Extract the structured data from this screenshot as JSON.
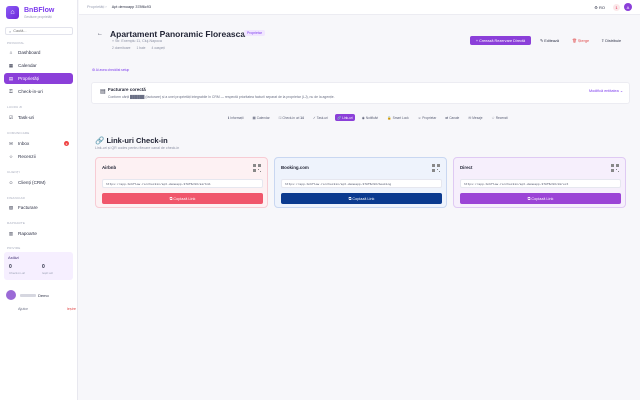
{
  "colors": {
    "accent": "#8b3fd9",
    "danger": "#e14b4b",
    "airbnb": "#f0566b",
    "booking": "#0b3a8f",
    "direct": "#9b44d6"
  },
  "sidebar": {
    "brand_name": "BnBFlow",
    "brand_sub": "Gestiune proprietăți",
    "search_placeholder": "Caută...",
    "sections": [
      "Principal",
      "Lucru zi",
      "Comunicare",
      "Clienți",
      "Financiar",
      "Rapoarte",
      "Privire"
    ],
    "items": [
      {
        "label": "Dashboard",
        "icon": "home-icon"
      },
      {
        "label": "Calendar",
        "icon": "calendar-icon"
      },
      {
        "label": "Proprietăți",
        "icon": "building-icon"
      },
      {
        "label": "Check-in-uri",
        "icon": "key-icon"
      },
      {
        "label": "Task-uri",
        "icon": "checklist-icon"
      },
      {
        "label": "Inbox",
        "icon": "inbox-icon",
        "badge": "3"
      },
      {
        "label": "Recenzii",
        "icon": "star-icon"
      },
      {
        "label": "Clienți (CRM)",
        "icon": "users-icon"
      },
      {
        "label": "Facturare",
        "icon": "invoice-icon"
      },
      {
        "label": "Rapoarte",
        "icon": "chart-icon"
      }
    ],
    "activity": {
      "title": "Astăzi",
      "checkins": "0",
      "checkins_label": "Check-in-uri",
      "checkouts": "0",
      "checkouts_label": "Ieșiri azi"
    },
    "user_name": "Demo",
    "account": "Ajutor",
    "logout": "Ieșire"
  },
  "topbar": {
    "crumb_root": "Proprietăți",
    "crumb_current": "Apt demoapp 378f6c93",
    "lang": "RO",
    "bell_count": "1",
    "avatar": "A"
  },
  "header": {
    "title": "Apartament Panoramic Floreasca",
    "badge": "Proprietar",
    "address": "Str. Exemplu 11, Cluj-Napoca",
    "stats": [
      "2 dormitoare",
      "1 baie",
      "4 oaspeți"
    ],
    "primary_btn": "+ Creează Rezervare Directă",
    "edit_btn": "Editează",
    "delete_btn": "Șterge",
    "share_btn": "Distribuie"
  },
  "notice_link": "Ai avea checklist setup",
  "invoice": {
    "title": "Facturare corectă",
    "text": "Conform cărții ██████ (facturare) și a unei proprietăți integrabile în CRM — respectă prioritatea facturii separat de la proprietar (LJ), nu de la agenție.",
    "modify": "Modifică entitatea ⌄"
  },
  "tabs": [
    {
      "label": "Informații",
      "icon": "ℹ"
    },
    {
      "label": "Calendar",
      "icon": "▦"
    },
    {
      "label": "Check-in uri",
      "icon": "⚿",
      "count": "14"
    },
    {
      "label": "Task-uri",
      "icon": "✓"
    },
    {
      "label": "Link-uri",
      "icon": "🔗",
      "active": true
    },
    {
      "label": "Notificări",
      "icon": "◉"
    },
    {
      "label": "Smart Lock",
      "icon": "🔒"
    },
    {
      "label": "Proprietar",
      "icon": "☺"
    },
    {
      "label": "Canale",
      "icon": "⇄"
    },
    {
      "label": "Mesaje",
      "icon": "✉"
    },
    {
      "label": "Recenzii",
      "icon": "☆"
    }
  ],
  "checkin": {
    "title": "Link-uri Check-in",
    "subtitle": "Link-uri și QR codes pentru fiecare canal de check-in",
    "cards": [
      {
        "name": "Airbnb",
        "url": "https://app.bnbflow.ro/checkin/apt-demoapp-378f6c93/airbnb",
        "button": "Copiază Link"
      },
      {
        "name": "Booking.com",
        "url": "https://app.bnbflow.ro/checkin/apt-demoapp-378f6c93/booking",
        "button": "Copiază Link"
      },
      {
        "name": "Direct",
        "url": "https://app.bnbflow.ro/checkin/apt-demoapp-378f6c93/direct",
        "button": "Copiază Link"
      }
    ]
  }
}
